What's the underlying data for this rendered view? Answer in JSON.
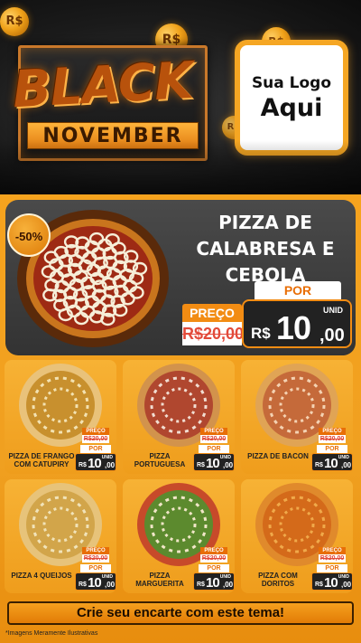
{
  "header": {
    "coins": [
      "R$",
      "R$",
      "R$",
      "R$"
    ],
    "title_black": "BLACK",
    "title_november": "NOVEMBER",
    "logo_line1": "Sua Logo",
    "logo_line2": "Aqui"
  },
  "featured": {
    "discount_badge": "-50%",
    "name": "PIZZA DE CALABRESA E CEBOLA",
    "por_label": "POR",
    "preco_label": "PREÇO",
    "old_price": "R$20,00",
    "unit_label": "UNID",
    "currency": "R$",
    "price_int": "10",
    "price_dec": ",00"
  },
  "products": [
    {
      "name": "PIZZA DE FRANGO COM CATUPIRY",
      "preco_label": "PREÇO",
      "old_price": "R$20,00",
      "por_label": "POR",
      "currency": "R$",
      "price_int": "10",
      "price_dec": ",00",
      "unit_label": "UNID"
    },
    {
      "name": "PIZZA PORTUGUESA",
      "preco_label": "PREÇO",
      "old_price": "R$20,00",
      "por_label": "POR",
      "currency": "R$",
      "price_int": "10",
      "price_dec": ",00",
      "unit_label": "UNID"
    },
    {
      "name": "PIZZA DE BACON",
      "preco_label": "PREÇO",
      "old_price": "R$20,00",
      "por_label": "POR",
      "currency": "R$",
      "price_int": "10",
      "price_dec": ",00",
      "unit_label": "UNID"
    },
    {
      "name": "PIZZA 4 QUEIJOS",
      "preco_label": "PREÇO",
      "old_price": "R$20,00",
      "por_label": "POR",
      "currency": "R$",
      "price_int": "10",
      "price_dec": ",00",
      "unit_label": "UNID"
    },
    {
      "name": "PIZZA MARGUERITA",
      "preco_label": "PREÇO",
      "old_price": "R$20,00",
      "por_label": "POR",
      "currency": "R$",
      "price_int": "10",
      "price_dec": ",00",
      "unit_label": "UNID"
    },
    {
      "name": "PIZZA COM DORITOS",
      "preco_label": "PREÇO",
      "old_price": "R$20,00",
      "por_label": "POR",
      "currency": "R$",
      "price_int": "10",
      "price_dec": ",00",
      "unit_label": "UNID"
    }
  ],
  "cta": "Crie seu encarte com este tema!",
  "footer_note": "*Imagens Meramente Ilustrativas",
  "colors": {
    "accent_orange": "#f28c13",
    "dark_panel": "#333333",
    "strike_red": "#e24a3a"
  }
}
